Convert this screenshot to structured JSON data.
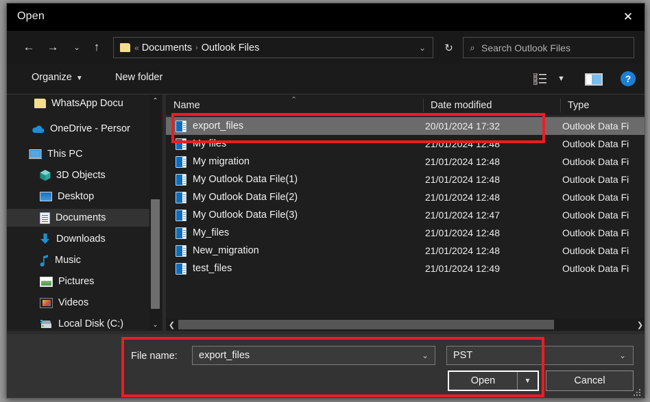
{
  "dialog": {
    "title": "Open",
    "close_icon": "close-icon"
  },
  "nav": {
    "back_icon": "←",
    "forward_icon": "→",
    "recent_icon": "⌄",
    "up_icon": "↑",
    "refresh_icon": "↻",
    "breadcrumb": {
      "folder_icon": "folder-icon",
      "leading_sep": "«",
      "items": [
        "Documents",
        "Outlook Files"
      ],
      "separator": "›",
      "dropdown_icon": "⌄"
    },
    "search": {
      "placeholder": "Search Outlook Files",
      "icon": "⌕",
      "value": ""
    }
  },
  "commandbar": {
    "organize_label": "Organize",
    "organize_caret": "▼",
    "new_folder_label": "New folder",
    "view_icon": "view-list-icon",
    "view_caret": "▼",
    "preview_pane_icon": "preview-pane-icon",
    "help_label": "?"
  },
  "sidebar": {
    "items": [
      {
        "label": "WhatsApp Docu",
        "icon": "folder-icon",
        "indent": 40,
        "selected": false
      },
      {
        "label": "OneDrive - Persor",
        "icon": "cloud-icon",
        "indent": 36,
        "selected": false
      },
      {
        "label": "This PC",
        "icon": "computer-icon",
        "indent": 32,
        "selected": false
      },
      {
        "label": "3D Objects",
        "icon": "cube-icon",
        "indent": 48,
        "selected": false
      },
      {
        "label": "Desktop",
        "icon": "desktop-icon",
        "indent": 48,
        "selected": false
      },
      {
        "label": "Documents",
        "icon": "document-icon",
        "indent": 48,
        "selected": true
      },
      {
        "label": "Downloads",
        "icon": "download-icon",
        "indent": 48,
        "selected": false
      },
      {
        "label": "Music",
        "icon": "music-note-icon",
        "indent": 48,
        "selected": false
      },
      {
        "label": "Pictures",
        "icon": "picture-icon",
        "indent": 48,
        "selected": false
      },
      {
        "label": "Videos",
        "icon": "video-icon",
        "indent": 48,
        "selected": false
      },
      {
        "label": "Local Disk (C:)",
        "icon": "disk-drive-icon",
        "indent": 48,
        "selected": false
      }
    ],
    "scroll_up_icon": "⌃",
    "scroll_down_icon": "⌄"
  },
  "filelist": {
    "columns": [
      "Name",
      "Date modified",
      "Type"
    ],
    "sort_indicator": "⌃",
    "rows": [
      {
        "name": "export_files",
        "date": "20/01/2024 17:32",
        "type": "Outlook Data Fi",
        "selected": true
      },
      {
        "name": "My files",
        "date": "21/01/2024 12:48",
        "type": "Outlook Data Fi",
        "selected": false
      },
      {
        "name": "My migration",
        "date": "21/01/2024 12:48",
        "type": "Outlook Data Fi",
        "selected": false
      },
      {
        "name": "My Outlook Data File(1)",
        "date": "21/01/2024 12:48",
        "type": "Outlook Data Fi",
        "selected": false
      },
      {
        "name": "My Outlook Data File(2)",
        "date": "21/01/2024 12:48",
        "type": "Outlook Data Fi",
        "selected": false
      },
      {
        "name": "My Outlook Data File(3)",
        "date": "21/01/2024 12:47",
        "type": "Outlook Data Fi",
        "selected": false
      },
      {
        "name": "My_files",
        "date": "21/01/2024 12:48",
        "type": "Outlook Data Fi",
        "selected": false
      },
      {
        "name": "New_migration",
        "date": "21/01/2024 12:48",
        "type": "Outlook Data Fi",
        "selected": false
      },
      {
        "name": "test_files",
        "date": "21/01/2024 12:49",
        "type": "Outlook Data Fi",
        "selected": false
      }
    ],
    "hscroll_left_icon": "❮",
    "hscroll_right_icon": "❯"
  },
  "form": {
    "file_name_label": "File name:",
    "file_name_value": "export_files",
    "file_name_caret": "⌄",
    "file_type_value": "PST",
    "file_type_caret": "⌄",
    "open_label": "Open",
    "open_split_caret": "▼",
    "cancel_label": "Cancel"
  },
  "annotations": {
    "highlight_color": "#ed1c24",
    "boxes": [
      "selected-file-row",
      "bottom-form-area"
    ]
  }
}
